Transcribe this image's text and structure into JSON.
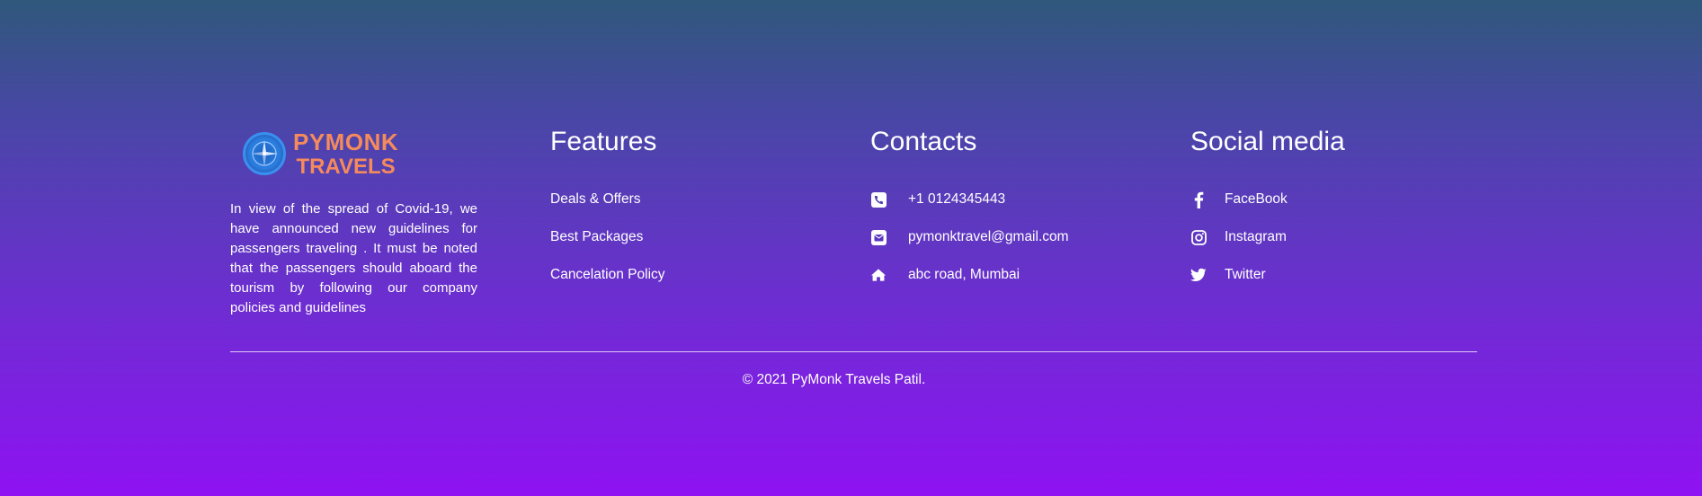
{
  "brand": {
    "logo_line1": "PYMONK",
    "logo_line2": "TRAVELS",
    "about": "In view of the spread of Covid-19, we have announced new guidelines for passengers traveling . It must be noted that the passengers should aboard the tourism by following our company policies and guidelines",
    "logo_color": "#f58a5c"
  },
  "features": {
    "title": "Features",
    "items": [
      {
        "label": "Deals & Offers"
      },
      {
        "label": "Best Packages"
      },
      {
        "label": "Cancelation Policy"
      }
    ]
  },
  "contacts": {
    "title": "Contacts",
    "items": [
      {
        "icon": "phone-icon",
        "label": "+1 0124345443"
      },
      {
        "icon": "envelope-icon",
        "label": "pymonktravel@gmail.com"
      },
      {
        "icon": "home-icon",
        "label": "abc road, Mumbai"
      }
    ]
  },
  "social": {
    "title": "Social media",
    "items": [
      {
        "icon": "facebook-icon",
        "label": "FaceBook"
      },
      {
        "icon": "instagram-icon",
        "label": "Instagram"
      },
      {
        "icon": "twitter-icon",
        "label": "Twitter"
      }
    ]
  },
  "copyright": "© 2021 PyMonk Travels Patil.",
  "colors": {
    "gradient_top": "#2f587b",
    "gradient_bottom": "#8f12f3",
    "text": "#ffffff"
  }
}
